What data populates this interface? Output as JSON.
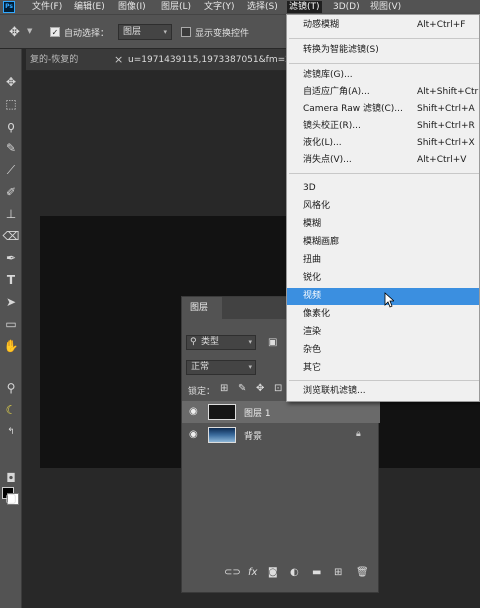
{
  "app": {
    "logo": "Ps"
  },
  "menubar": {
    "items": [
      "文件(F)",
      "编辑(E)",
      "图像(I)",
      "图层(L)",
      "文字(Y)",
      "选择(S)",
      "滤镜(T)",
      "3D(D)",
      "视图(V)"
    ],
    "active": "滤镜(T)"
  },
  "options": {
    "auto_select_label": "自动选择：",
    "auto_select_checked": true,
    "auto_select_target": "图层",
    "show_transform_label": "显示变换控件",
    "show_transform_checked": false
  },
  "tabs": [
    {
      "title": "复的-恢复的",
      "close": "×"
    },
    {
      "title": "u=1971439115,1973387051&fm=27"
    }
  ],
  "filter_menu": {
    "items": [
      {
        "label": "动感模糊",
        "shortcut": "Alt+Ctrl+F"
      },
      {
        "label": "转换为智能滤镜(S)",
        "shortcut": ""
      },
      {
        "label": "滤镜库(G)...",
        "shortcut": ""
      },
      {
        "label": "自适应广角(A)...",
        "shortcut": "Alt+Shift+Ctrl+A"
      },
      {
        "label": "Camera Raw 滤镜(C)...",
        "shortcut": "Shift+Ctrl+A"
      },
      {
        "label": "镜头校正(R)...",
        "shortcut": "Shift+Ctrl+R"
      },
      {
        "label": "液化(L)...",
        "shortcut": "Shift+Ctrl+X"
      },
      {
        "label": "消失点(V)...",
        "shortcut": "Alt+Ctrl+V"
      },
      {
        "label": "3D",
        "shortcut": ""
      },
      {
        "label": "风格化",
        "shortcut": ""
      },
      {
        "label": "模糊",
        "shortcut": ""
      },
      {
        "label": "模糊画廊",
        "shortcut": ""
      },
      {
        "label": "扭曲",
        "shortcut": ""
      },
      {
        "label": "锐化",
        "shortcut": ""
      },
      {
        "label": "视频",
        "shortcut": ""
      },
      {
        "label": "像素化",
        "shortcut": ""
      },
      {
        "label": "渲染",
        "shortcut": ""
      },
      {
        "label": "杂色",
        "shortcut": ""
      },
      {
        "label": "其它",
        "shortcut": ""
      },
      {
        "label": "浏览联机滤镜...",
        "shortcut": ""
      }
    ],
    "highlighted": "视频"
  },
  "layers_panel": {
    "title": "图层",
    "filter_kind": "类型",
    "blend_mode": "正常",
    "lock_label": "锁定：",
    "layers": [
      {
        "name": "图层 1",
        "selected": true,
        "thumb": "dark",
        "locked": false
      },
      {
        "name": "背景",
        "selected": false,
        "thumb": "sea",
        "locked": true
      }
    ],
    "footer_icons": [
      "link-icon",
      "fx-icon",
      "mask-icon",
      "adjustment-icon",
      "folder-icon",
      "new-layer-icon",
      "trash-icon"
    ],
    "footer_fx_text": "fx"
  },
  "colors": {
    "menu_highlight": "#3b8fe0",
    "ui_gray": "#535353",
    "foreground": "#000000",
    "background": "#ffffff"
  }
}
